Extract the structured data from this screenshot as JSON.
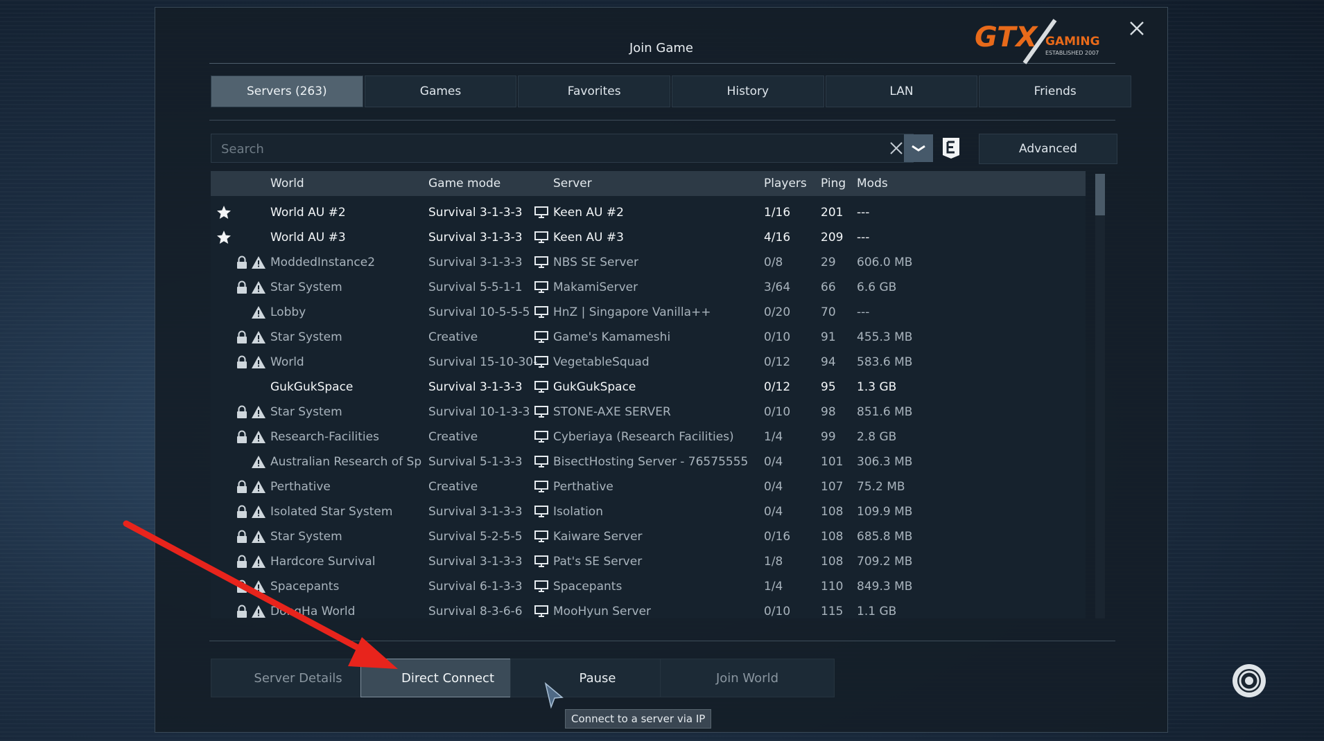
{
  "dialog": {
    "title": "Join Game",
    "logo": {
      "brand": "GTX",
      "tagline": "GAMING",
      "subline": "ESTABLISHED 2007"
    }
  },
  "tabs": [
    {
      "label": "Servers (263)",
      "active": true
    },
    {
      "label": "Games",
      "active": false
    },
    {
      "label": "Favorites",
      "active": false
    },
    {
      "label": "History",
      "active": false
    },
    {
      "label": "LAN",
      "active": false
    },
    {
      "label": "Friends",
      "active": false
    }
  ],
  "search": {
    "placeholder": "Search",
    "value": ""
  },
  "advanced_label": "Advanced",
  "table": {
    "headers": {
      "world": "World",
      "mode": "Game mode",
      "server": "Server",
      "players": "Players",
      "ping": "Ping",
      "mods": "Mods"
    },
    "rows": [
      {
        "fav": true,
        "lock": false,
        "warn": false,
        "world": "World AU #2",
        "mode": "Survival 3-1-3-3",
        "server": "Keen AU #2",
        "players": "1/16",
        "ping": "201",
        "mods": "---",
        "style": "bright"
      },
      {
        "fav": true,
        "lock": false,
        "warn": false,
        "world": "World AU #3",
        "mode": "Survival 3-1-3-3",
        "server": "Keen AU #3",
        "players": "4/16",
        "ping": "209",
        "mods": "---",
        "style": "bright"
      },
      {
        "fav": false,
        "lock": true,
        "warn": true,
        "world": "ModdedInstance2",
        "mode": "Survival 3-1-3-3",
        "server": "NBS SE Server",
        "players": "0/8",
        "ping": "29",
        "mods": "606.0 MB",
        "style": "dim"
      },
      {
        "fav": false,
        "lock": true,
        "warn": true,
        "world": "Star System",
        "mode": "Survival 5-5-1-1",
        "server": "MakamiServer",
        "players": "3/64",
        "ping": "66",
        "mods": "6.6 GB",
        "style": "dim"
      },
      {
        "fav": false,
        "lock": false,
        "warn": true,
        "world": "Lobby",
        "mode": "Survival 10-5-5-5",
        "server": "HnZ | Singapore Vanilla++",
        "players": "0/20",
        "ping": "70",
        "mods": "---",
        "style": "dim"
      },
      {
        "fav": false,
        "lock": true,
        "warn": true,
        "world": "Star System",
        "mode": "Creative",
        "server": "Game's Kamameshi",
        "players": "0/10",
        "ping": "91",
        "mods": "455.3 MB",
        "style": "dim"
      },
      {
        "fav": false,
        "lock": true,
        "warn": true,
        "world": "World",
        "mode": "Survival 15-10-30-",
        "server": "VegetableSquad",
        "players": "0/12",
        "ping": "94",
        "mods": "583.6 MB",
        "style": "dim"
      },
      {
        "fav": false,
        "lock": false,
        "warn": false,
        "world": "GukGukSpace",
        "mode": "Survival 3-1-3-3",
        "server": "GukGukSpace",
        "players": "0/12",
        "ping": "95",
        "mods": "1.3 GB",
        "style": "bright"
      },
      {
        "fav": false,
        "lock": true,
        "warn": true,
        "world": "Star System",
        "mode": "Survival 10-1-3-3",
        "server": "STONE-AXE SERVER",
        "players": "0/10",
        "ping": "98",
        "mods": "851.6 MB",
        "style": "dim"
      },
      {
        "fav": false,
        "lock": true,
        "warn": true,
        "world": "Research-Facilities",
        "mode": "Creative",
        "server": "Cyberiaya (Research Facilities)",
        "players": "1/4",
        "ping": "99",
        "mods": "2.8 GB",
        "style": "dim"
      },
      {
        "fav": false,
        "lock": false,
        "warn": true,
        "world": "Australian Research of Sp",
        "mode": "Survival 5-1-3-3",
        "server": "BisectHosting Server - 76575555",
        "players": "0/4",
        "ping": "101",
        "mods": "306.3 MB",
        "style": "dim"
      },
      {
        "fav": false,
        "lock": true,
        "warn": true,
        "world": "Perthative",
        "mode": "Creative",
        "server": "Perthative",
        "players": "0/4",
        "ping": "107",
        "mods": "75.2 MB",
        "style": "dim"
      },
      {
        "fav": false,
        "lock": true,
        "warn": true,
        "world": "Isolated Star System",
        "mode": "Survival 3-1-3-3",
        "server": "Isolation",
        "players": "0/4",
        "ping": "108",
        "mods": "109.9 MB",
        "style": "dim"
      },
      {
        "fav": false,
        "lock": true,
        "warn": true,
        "world": "Star System",
        "mode": "Survival 5-2-5-5",
        "server": "Kaiware Server",
        "players": "0/16",
        "ping": "108",
        "mods": "685.8 MB",
        "style": "dim"
      },
      {
        "fav": false,
        "lock": true,
        "warn": true,
        "world": "Hardcore Survival",
        "mode": "Survival 3-1-3-3",
        "server": "Pat's SE Server",
        "players": "1/8",
        "ping": "108",
        "mods": "709.2 MB",
        "style": "dim"
      },
      {
        "fav": false,
        "lock": true,
        "warn": true,
        "world": "Spacepants",
        "mode": "Survival 6-1-3-3",
        "server": "Spacepants",
        "players": "1/4",
        "ping": "110",
        "mods": "849.3 MB",
        "style": "dim"
      },
      {
        "fav": false,
        "lock": true,
        "warn": true,
        "world": "DongHa World",
        "mode": "Survival 8-3-6-6",
        "server": "MooHyun Server",
        "players": "0/10",
        "ping": "115",
        "mods": "1.1 GB",
        "style": "dim"
      }
    ]
  },
  "buttons": {
    "server_details": "Server Details",
    "direct_connect": "Direct Connect",
    "pause": "Pause",
    "join_world": "Join World"
  },
  "tooltip": "Connect to a server via IP",
  "colors": {
    "annotation_arrow": "#e8241c",
    "logo_orange": "#e86a1a"
  }
}
